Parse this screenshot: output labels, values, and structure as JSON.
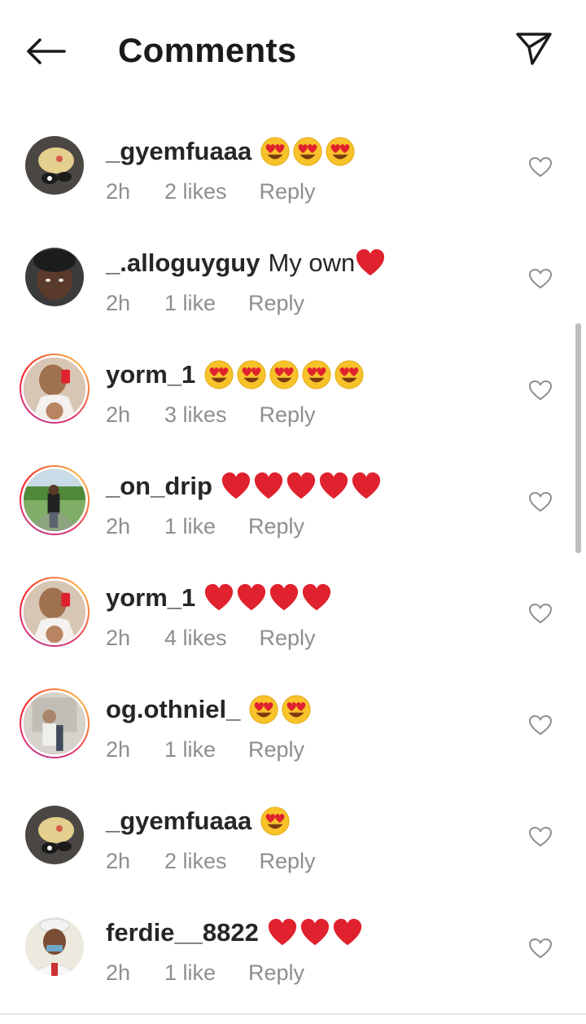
{
  "header": {
    "title": "Comments",
    "back_icon": "back-arrow-icon",
    "share_icon": "send-icon"
  },
  "colors": {
    "username": "#262626",
    "meta": "#8e8e8e",
    "heart_emoji": "#e0212e",
    "heart_eyes_face": "#f7c22a",
    "story_ring": "#e1306c"
  },
  "comments": [
    {
      "username": "_gyemfuaaa",
      "text": "",
      "emojis": [
        "heart-eyes",
        "heart-eyes",
        "heart-eyes"
      ],
      "time": "2h",
      "likes": "2 likes",
      "reply": "Reply",
      "story": false,
      "avatar": "avatar-photo-1"
    },
    {
      "username": "_.alloguyguy",
      "text": "My own",
      "emojis": [
        "red-heart"
      ],
      "time": "2h",
      "likes": "1 like",
      "reply": "Reply",
      "story": false,
      "avatar": "avatar-photo-2"
    },
    {
      "username": "yorm_1",
      "text": "",
      "emojis": [
        "heart-eyes",
        "heart-eyes",
        "heart-eyes",
        "heart-eyes",
        "heart-eyes"
      ],
      "time": "2h",
      "likes": "3 likes",
      "reply": "Reply",
      "story": true,
      "avatar": "avatar-photo-3"
    },
    {
      "username": "_on_drip",
      "text": "",
      "emojis": [
        "red-heart",
        "red-heart",
        "red-heart",
        "red-heart",
        "red-heart"
      ],
      "time": "2h",
      "likes": "1 like",
      "reply": "Reply",
      "story": true,
      "avatar": "avatar-photo-4"
    },
    {
      "username": "yorm_1",
      "text": "",
      "emojis": [
        "red-heart",
        "red-heart",
        "red-heart",
        "red-heart"
      ],
      "time": "2h",
      "likes": "4 likes",
      "reply": "Reply",
      "story": true,
      "avatar": "avatar-photo-3"
    },
    {
      "username": "og.othniel_",
      "text": "",
      "emojis": [
        "heart-eyes",
        "heart-eyes"
      ],
      "time": "2h",
      "likes": "1 like",
      "reply": "Reply",
      "story": true,
      "avatar": "avatar-photo-5"
    },
    {
      "username": "_gyemfuaaa",
      "text": "",
      "emojis": [
        "heart-eyes"
      ],
      "time": "2h",
      "likes": "2 likes",
      "reply": "Reply",
      "story": false,
      "avatar": "avatar-photo-1"
    },
    {
      "username": "ferdie__8822",
      "text": "",
      "emojis": [
        "red-heart",
        "red-heart",
        "red-heart"
      ],
      "time": "2h",
      "likes": "1 like",
      "reply": "Reply",
      "story": false,
      "avatar": "avatar-photo-6"
    }
  ]
}
